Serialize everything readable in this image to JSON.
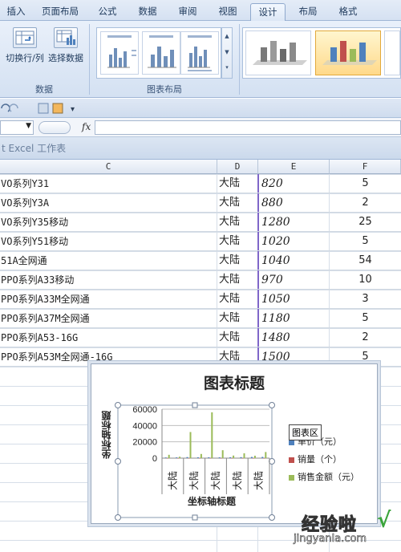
{
  "ribbon": {
    "tabs": [
      "插入",
      "页面布局",
      "公式",
      "数据",
      "审阅",
      "视图",
      "设计",
      "布局",
      "格式"
    ],
    "active_tab": "设计",
    "buttons": {
      "switch_row_col": "切换行/列",
      "select_data": "选择数据"
    },
    "groups": {
      "data": "数据",
      "chart_layout": "图表布局"
    }
  },
  "formula_bar": {
    "fx": "fx",
    "name_box": ""
  },
  "workbook": {
    "title": "t Excel 工作表"
  },
  "columns": [
    "C",
    "D",
    "E",
    "F"
  ],
  "rows": [
    {
      "name": "VO系列Y31",
      "region": "大陆",
      "price": "820",
      "qty": "5"
    },
    {
      "name": "VO系列Y3A",
      "region": "大陆",
      "price": "880",
      "qty": "2"
    },
    {
      "name": "VO系列Y35移动",
      "region": "大陆",
      "price": "1280",
      "qty": "25"
    },
    {
      "name": "VO系列Y51移动",
      "region": "大陆",
      "price": "1020",
      "qty": "5"
    },
    {
      "name": "51A全网通",
      "region": "大陆",
      "price": "1040",
      "qty": "54"
    },
    {
      "name": "PPO系列A33移动",
      "region": "大陆",
      "price": "970",
      "qty": "10"
    },
    {
      "name": "PPO系列A33M全网通",
      "region": "大陆",
      "price": "1050",
      "qty": "3"
    },
    {
      "name": "PPO系列A37M全网通",
      "region": "大陆",
      "price": "1180",
      "qty": "5"
    },
    {
      "name": "PPO系列A53-16G",
      "region": "大陆",
      "price": "1480",
      "qty": "2"
    },
    {
      "name": "PPO系列A53M全网通-16G",
      "region": "大陆",
      "price": "1500",
      "qty": "5"
    }
  ],
  "chart": {
    "title": "图表标题",
    "y_axis_title": "坐标轴标题",
    "x_axis_title": "坐标轴标题",
    "tooltip": "图表区",
    "legend": [
      {
        "label": "单价（元）",
        "color": "#4f81bd"
      },
      {
        "label": "销量（个）",
        "color": "#c0504d"
      },
      {
        "label": "销售金额（元）",
        "color": "#9bbb59"
      }
    ]
  },
  "chart_data": {
    "type": "bar",
    "title": "图表标题",
    "xlabel": "坐标轴标题",
    "ylabel": "坐标轴标题",
    "ylim": [
      0,
      60000
    ],
    "yticks": [
      0,
      20000,
      40000,
      60000
    ],
    "tick_labels": [
      "大陆",
      "大陆",
      "大陆",
      "大陆",
      "大陆"
    ],
    "categories": [
      "大陆",
      "大陆",
      "大陆",
      "大陆",
      "大陆",
      "大陆",
      "大陆",
      "大陆",
      "大陆",
      "大陆"
    ],
    "series": [
      {
        "name": "单价（元）",
        "color": "#4f81bd",
        "values": [
          820,
          880,
          1280,
          1020,
          1040,
          970,
          1050,
          1180,
          1480,
          1500
        ]
      },
      {
        "name": "销量（个）",
        "color": "#c0504d",
        "values": [
          5,
          2,
          25,
          5,
          54,
          10,
          3,
          5,
          2,
          5
        ]
      },
      {
        "name": "销售金额（元）",
        "color": "#9bbb59",
        "values": [
          4100,
          1760,
          32000,
          5100,
          56160,
          9700,
          3150,
          5900,
          2960,
          7500
        ]
      }
    ],
    "legend": "right",
    "grid": true
  },
  "watermark": {
    "big": "经验啦",
    "small": "jingyanla.com",
    "check": "√"
  }
}
